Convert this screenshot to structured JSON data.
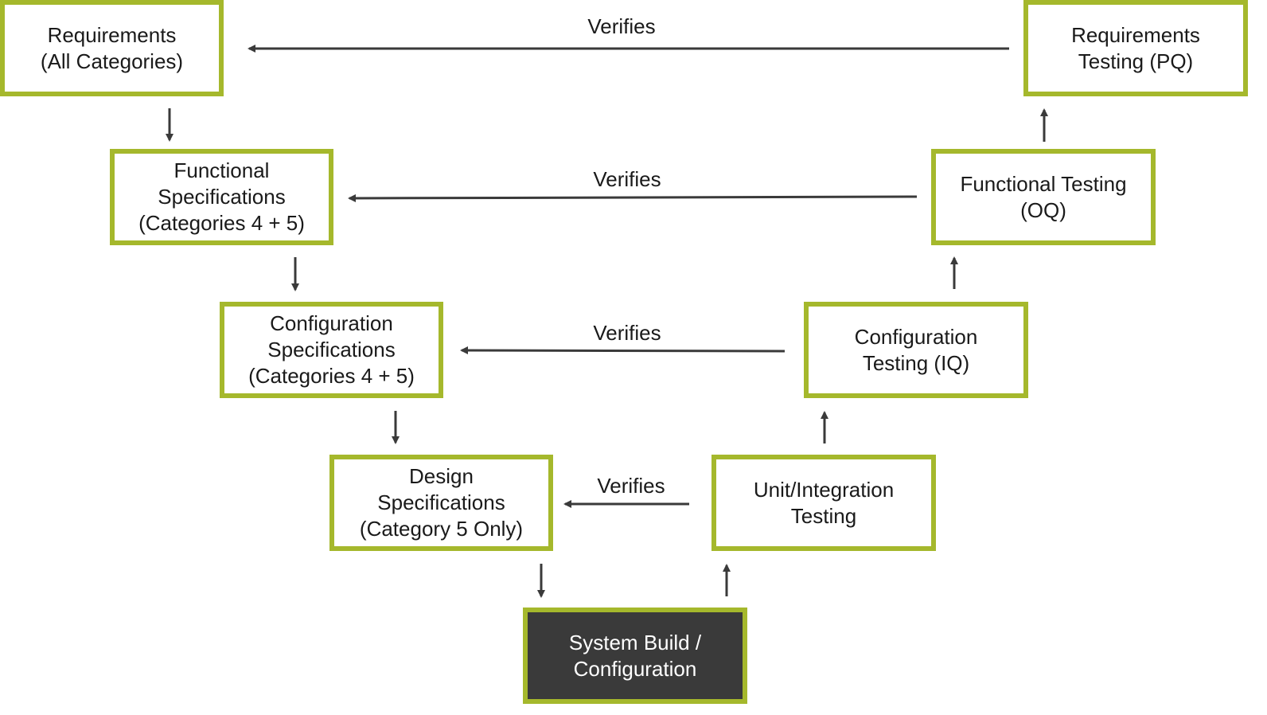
{
  "diagram": {
    "type": "V-model validation lifecycle",
    "colors": {
      "box_border": "#a5b82c",
      "box_fill": "#ffffff",
      "dark_box_fill": "#3a3a3a",
      "arrow": "#3a3a3a",
      "text": "#1a1a1a",
      "dark_box_text": "#ffffff"
    },
    "left_boxes": [
      {
        "id": "req",
        "label": "Requirements\n(All Categories)"
      },
      {
        "id": "func-spec",
        "label": "Functional\nSpecifications\n(Categories 4 + 5)"
      },
      {
        "id": "config-spec",
        "label": "Configuration\nSpecifications\n(Categories 4 + 5)"
      },
      {
        "id": "design-spec",
        "label": "Design\nSpecifications\n(Category 5 Only)"
      }
    ],
    "right_boxes": [
      {
        "id": "req-test",
        "label": "Requirements\nTesting (PQ)"
      },
      {
        "id": "func-test",
        "label": "Functional Testing\n(OQ)"
      },
      {
        "id": "config-test",
        "label": "Configuration\nTesting (IQ)"
      },
      {
        "id": "unit-test",
        "label": "Unit/Integration\nTesting"
      }
    ],
    "bottom_box": {
      "id": "build",
      "label": "System Build /\nConfiguration"
    },
    "verifies_links": [
      {
        "from": "req-test",
        "to": "req",
        "label": "Verifies"
      },
      {
        "from": "func-test",
        "to": "func-spec",
        "label": "Verifies"
      },
      {
        "from": "config-test",
        "to": "config-spec",
        "label": "Verifies"
      },
      {
        "from": "unit-test",
        "to": "design-spec",
        "label": "Verifies"
      }
    ],
    "flow_arrows": [
      {
        "from": "req",
        "to": "func-spec",
        "direction": "down"
      },
      {
        "from": "func-spec",
        "to": "config-spec",
        "direction": "down"
      },
      {
        "from": "config-spec",
        "to": "design-spec",
        "direction": "down"
      },
      {
        "from": "design-spec",
        "to": "build",
        "direction": "down"
      },
      {
        "from": "build",
        "to": "unit-test",
        "direction": "up"
      },
      {
        "from": "unit-test",
        "to": "config-test",
        "direction": "up"
      },
      {
        "from": "config-test",
        "to": "func-test",
        "direction": "up"
      },
      {
        "from": "func-test",
        "to": "req-test",
        "direction": "up"
      }
    ]
  }
}
